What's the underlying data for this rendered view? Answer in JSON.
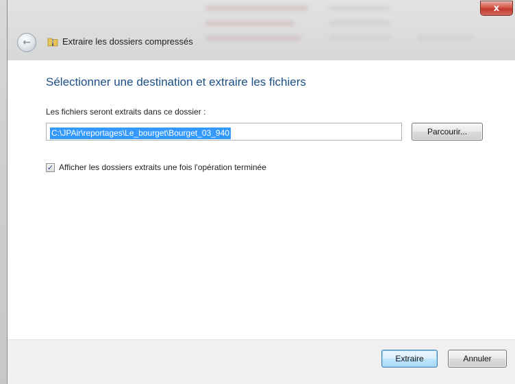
{
  "window": {
    "title": "Extraire les dossiers compressés",
    "close_label": "x"
  },
  "main": {
    "heading": "Sélectionner une destination et extraire les fichiers",
    "destination_label": "Les fichiers seront extraits dans ce dossier :",
    "destination_path": "C:\\JPAir\\reportages\\Le_bourget\\Bourget_03_940",
    "browse_label": "Parcourir...",
    "show_folders_label": "Afficher les dossiers extraits une fois l'opération terminée",
    "show_folders_checked": true
  },
  "footer": {
    "extract_label": "Extraire",
    "cancel_label": "Annuler"
  },
  "colors": {
    "heading": "#1c4f86",
    "selection": "#3399ff",
    "close_button": "#c0392b"
  }
}
